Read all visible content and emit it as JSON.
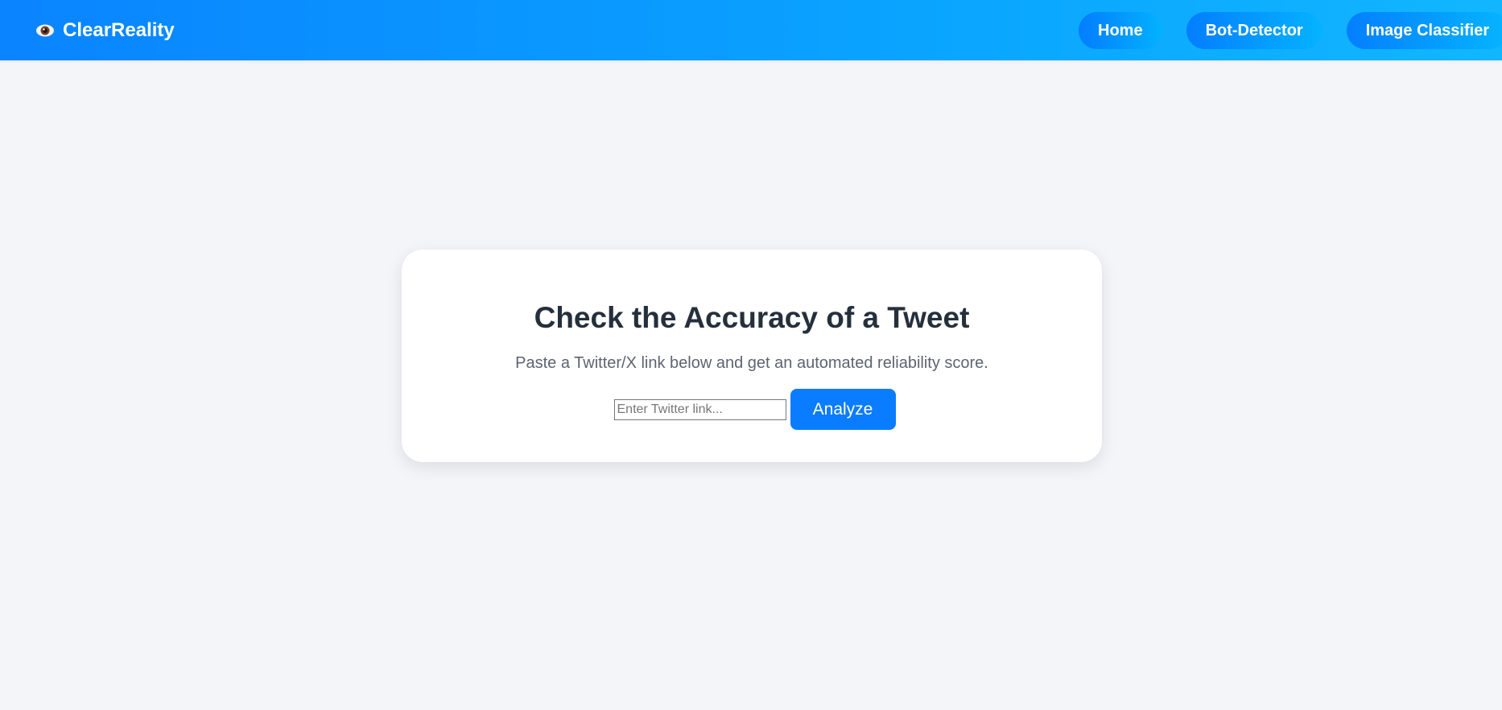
{
  "header": {
    "brand": "ClearReality",
    "brand_icon": "eye-icon",
    "nav": [
      {
        "label": "Home"
      },
      {
        "label": "Bot-Detector"
      },
      {
        "label": "Image Classifier"
      }
    ]
  },
  "card": {
    "title": "Check the Accuracy of a Tweet",
    "subtitle": "Paste a Twitter/X link below and get an automated reliability score.",
    "input_placeholder": "Enter Twitter link...",
    "input_value": "",
    "button_label": "Analyze"
  },
  "colors": {
    "header_gradient_start": "#0a84ff",
    "header_gradient_end": "#12b6ff",
    "accent_button": "#0a7cff",
    "page_background": "#f4f5f9",
    "title_text": "#25303c"
  }
}
